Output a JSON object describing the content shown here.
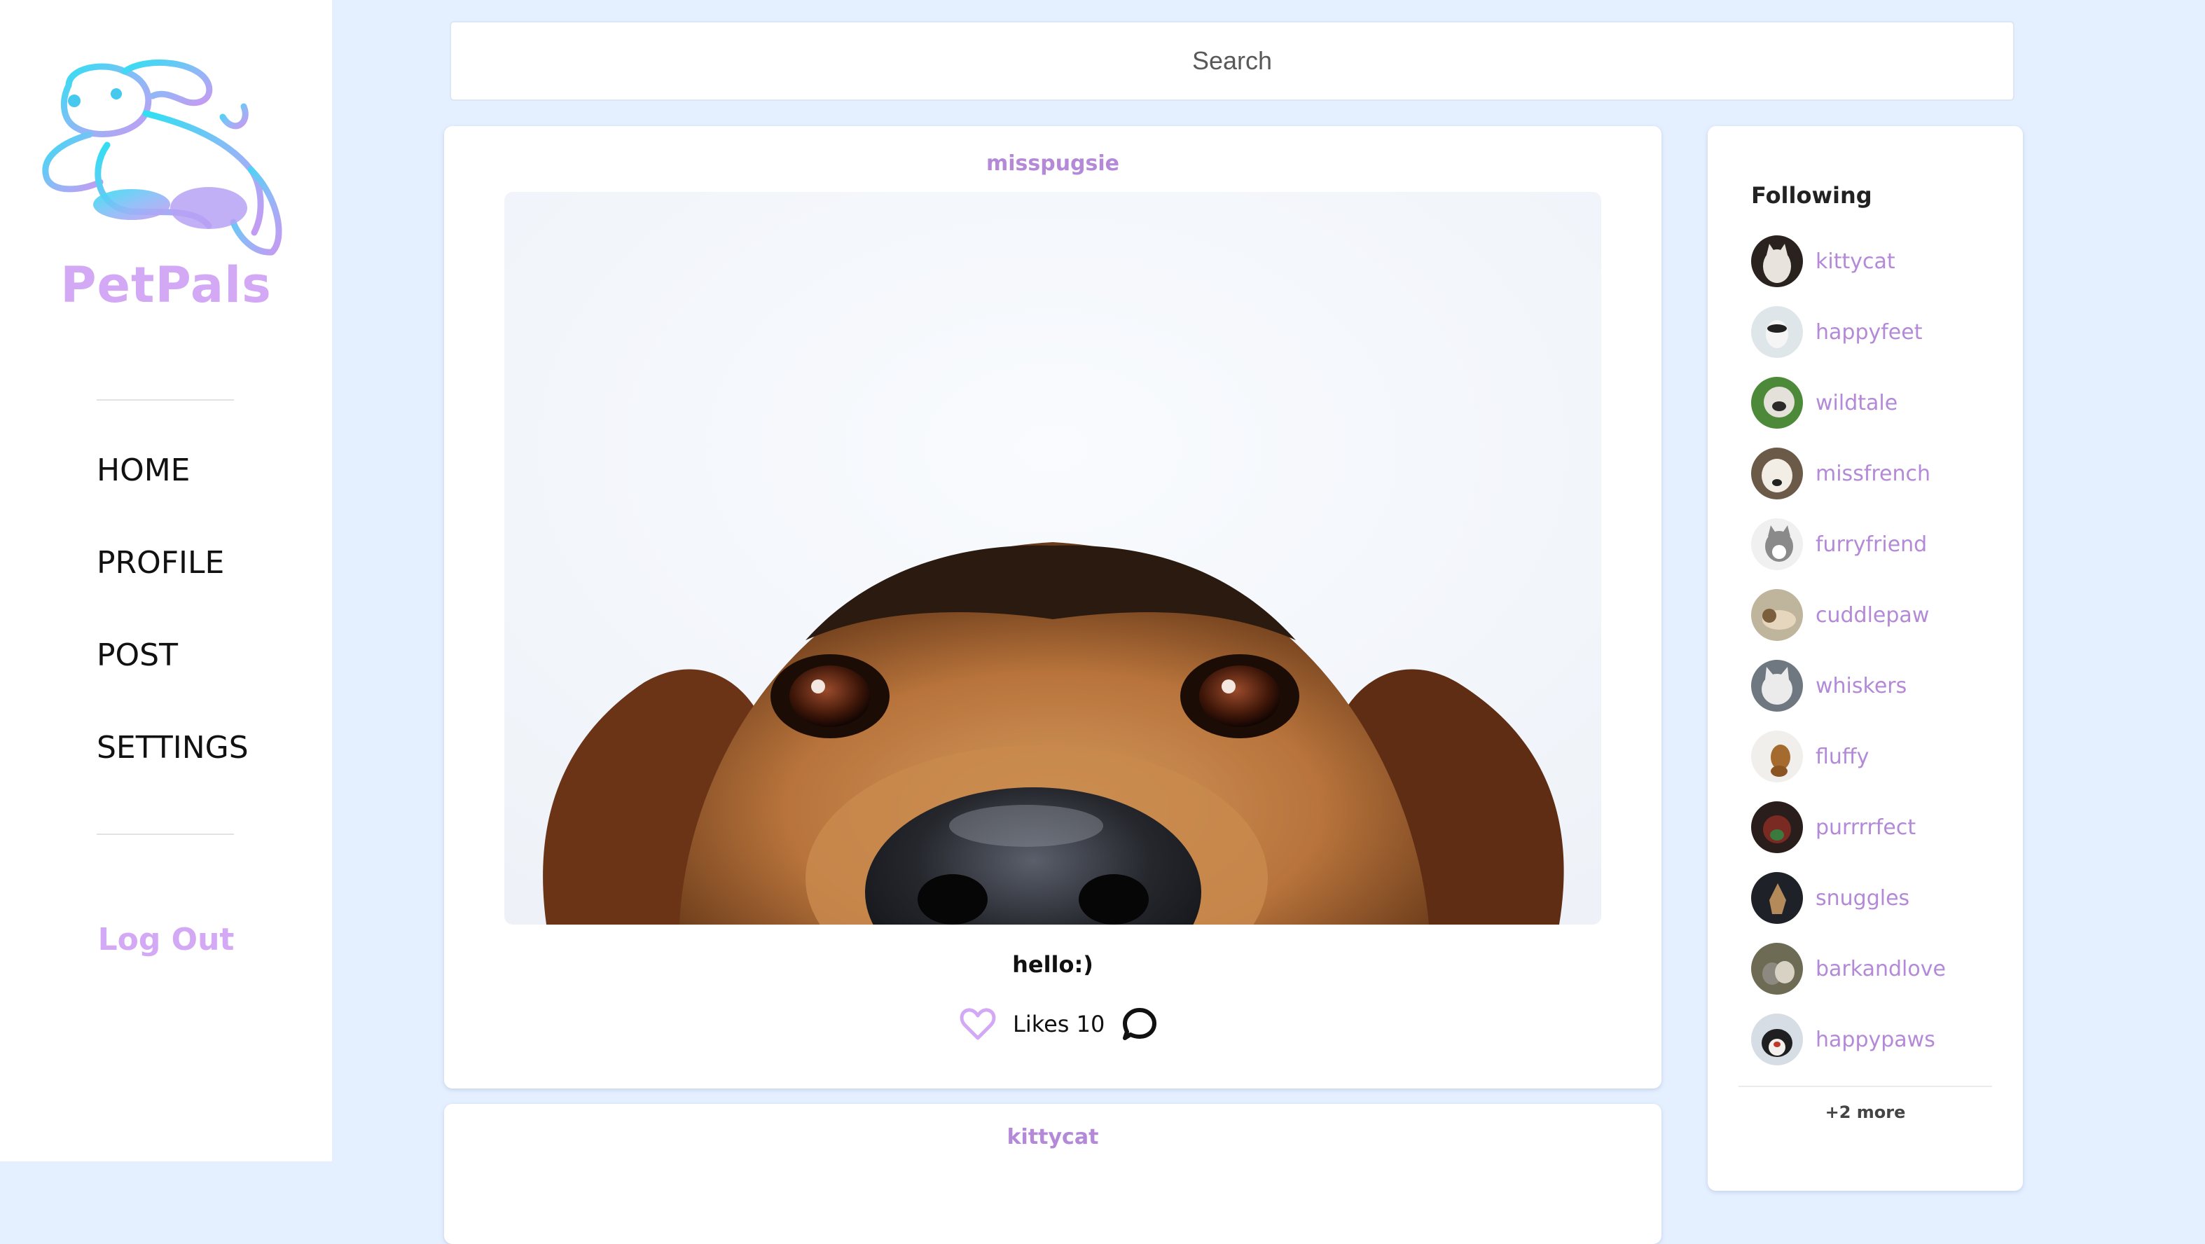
{
  "brand": {
    "name": "PetPals",
    "logo_icon": "flying-dog-logo",
    "color": "#d3a8f5"
  },
  "nav": {
    "items": [
      {
        "label": "HOME"
      },
      {
        "label": "PROFILE"
      },
      {
        "label": "POST"
      },
      {
        "label": "SETTINGS"
      }
    ],
    "logout_label": "Log Out"
  },
  "search": {
    "placeholder": "Search"
  },
  "posts": [
    {
      "user": "misspugsie",
      "image_subject": "dog-peeking-photo",
      "caption": "hello:)",
      "likes_label": "Likes 10"
    },
    {
      "user": "kittycat"
    }
  ],
  "following": {
    "title": "Following",
    "users": [
      {
        "name": "kittycat"
      },
      {
        "name": "happyfeet"
      },
      {
        "name": "wildtale"
      },
      {
        "name": "missfrench"
      },
      {
        "name": "furryfriend"
      },
      {
        "name": "cuddlepaw"
      },
      {
        "name": "whiskers"
      },
      {
        "name": "fluffy"
      },
      {
        "name": "purrrrfect"
      },
      {
        "name": "snuggles"
      },
      {
        "name": "barkandlove"
      },
      {
        "name": "happypaws"
      }
    ],
    "more_label": "+2 more"
  },
  "colors": {
    "background": "#e4efff",
    "accent": "#b389d8",
    "heart": "#d3a8f5"
  }
}
